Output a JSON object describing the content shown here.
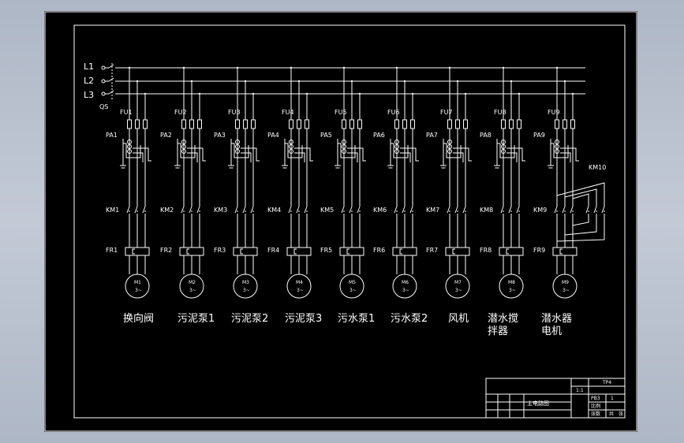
{
  "colors": {
    "background": "#000000",
    "stroke": "#ffffff",
    "window": "#b7bfcc"
  },
  "supply": {
    "phases": [
      "L1",
      "L2",
      "L3"
    ],
    "switch": "QS"
  },
  "circuits": [
    {
      "fuse": "FU1",
      "ammeter": "PA1",
      "contactor": "KM1",
      "relay": "FR1",
      "motor": "M1",
      "phase_mark": "3~",
      "caption": [
        "换向阀"
      ]
    },
    {
      "fuse": "FU2",
      "ammeter": "PA2",
      "contactor": "KM2",
      "relay": "FR2",
      "motor": "M2",
      "phase_mark": "3~",
      "caption": [
        "污泥泵1"
      ]
    },
    {
      "fuse": "FU3",
      "ammeter": "PA3",
      "contactor": "KM3",
      "relay": "FR3",
      "motor": "M3",
      "phase_mark": "3~",
      "caption": [
        "污泥泵2"
      ]
    },
    {
      "fuse": "FU4",
      "ammeter": "PA4",
      "contactor": "KM4",
      "relay": "FR4",
      "motor": "M4",
      "phase_mark": "3~",
      "caption": [
        "污泥泵3"
      ]
    },
    {
      "fuse": "FU5",
      "ammeter": "PA5",
      "contactor": "KM5",
      "relay": "FR5",
      "motor": "M5",
      "phase_mark": "3~",
      "caption": [
        "污水泵1"
      ]
    },
    {
      "fuse": "FU6",
      "ammeter": "PA6",
      "contactor": "KM6",
      "relay": "FR6",
      "motor": "M6",
      "phase_mark": "3~",
      "caption": [
        "污水泵2"
      ]
    },
    {
      "fuse": "FU7",
      "ammeter": "PA7",
      "contactor": "KM7",
      "relay": "FR7",
      "motor": "M7",
      "phase_mark": "3~",
      "caption": [
        "风机"
      ]
    },
    {
      "fuse": "FU8",
      "ammeter": "PA8",
      "contactor": "KM8",
      "relay": "FR8",
      "motor": "M8",
      "phase_mark": "3~",
      "caption": [
        "潜水搅",
        "拌器"
      ]
    },
    {
      "fuse": "FU9",
      "ammeter": "PA9",
      "contactor": "KM9",
      "relay": "FR9",
      "motor": "M9",
      "phase_mark": "3~",
      "caption": [
        "潜水器",
        "电机"
      ]
    }
  ],
  "reversing_contactor": "KM10",
  "title_block": {
    "drawing_name": "主电路图",
    "scale": "1:1",
    "sheet_no": "1",
    "cells": [
      "TP4",
      "PB3",
      "比例",
      "张数",
      "共",
      "张"
    ]
  }
}
